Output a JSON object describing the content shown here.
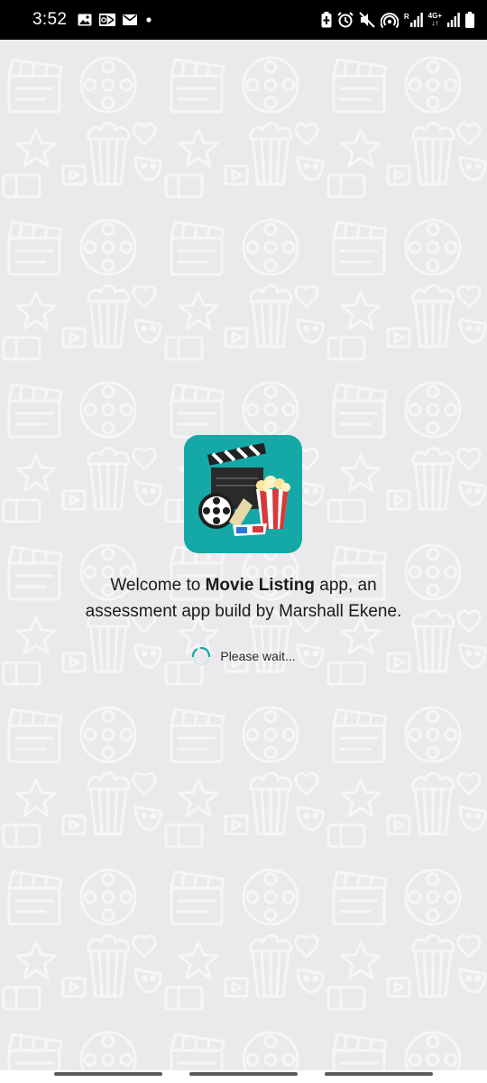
{
  "status_bar": {
    "time": "3:52",
    "network_label_top": "4G+",
    "network_label_bottom": "↓↑",
    "signal_r_label": "R"
  },
  "welcome": {
    "prefix": "Welcome to ",
    "app_name": "Movie Listing",
    "suffix": " app, an",
    "line2": "assessment app build by Marshall Ekene."
  },
  "loading": {
    "text": "Please wait...",
    "accent_color": "#14a8a6"
  },
  "colors": {
    "background": "#ebe9eb",
    "app_icon_bg": "#14a8a6",
    "status_bar": "#000000"
  },
  "icons": {
    "status_left": [
      "gallery-icon",
      "outlook-icon",
      "mail-icon",
      "notification-dot-icon"
    ],
    "status_right": [
      "battery-saver-icon",
      "alarm-icon",
      "mute-icon",
      "hotspot-icon",
      "signal-icon",
      "signal-icon",
      "battery-icon"
    ]
  }
}
